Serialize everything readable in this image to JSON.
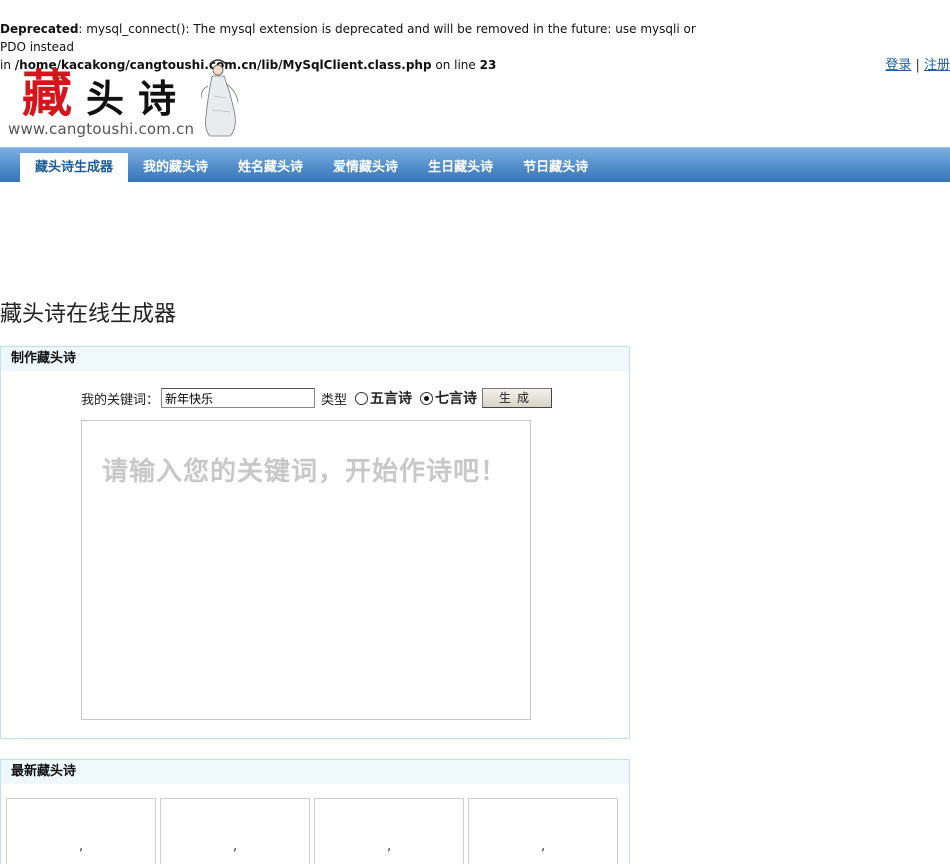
{
  "warning": {
    "label": "Deprecated",
    "message": ": mysql_connect(): The mysql extension is deprecated and will be removed in the future: use mysqli or PDO instead",
    "in_word": "in ",
    "path": "/home/kacakong/cangtoushi.com.cn/lib/MySqlClient.class.php",
    "on_line_text": " on line ",
    "line": "23"
  },
  "top_links": {
    "login": "登录",
    "separator": " | ",
    "register": "注册"
  },
  "logo": {
    "char1": "藏",
    "char2": "头",
    "char3": "诗",
    "url": "www.cangtoushi.com.cn"
  },
  "nav": {
    "items": [
      "藏头诗生成器",
      "我的藏头诗",
      "姓名藏头诗",
      "爱情藏头诗",
      "生日藏头诗",
      "节日藏头诗"
    ],
    "active_index": 0
  },
  "page_title": "藏头诗在线生成器",
  "make_panel": {
    "header": "制作藏头诗",
    "keyword_label": "我的关键词：",
    "keyword_value": "新年快乐",
    "type_label": "类型",
    "option_five": "五言诗",
    "option_seven": "七言诗",
    "selected": "七言诗",
    "generate_button": "生成",
    "placeholder": "请输入您的关键词，开始作诗吧！"
  },
  "latest_panel": {
    "header": "最新藏头诗",
    "cards": [
      ",",
      ",",
      ",",
      ","
    ]
  },
  "colors": {
    "nav_blue": "#4f8bc9",
    "logo_red": "#d4161c",
    "panel_border": "#bfe0ec"
  }
}
